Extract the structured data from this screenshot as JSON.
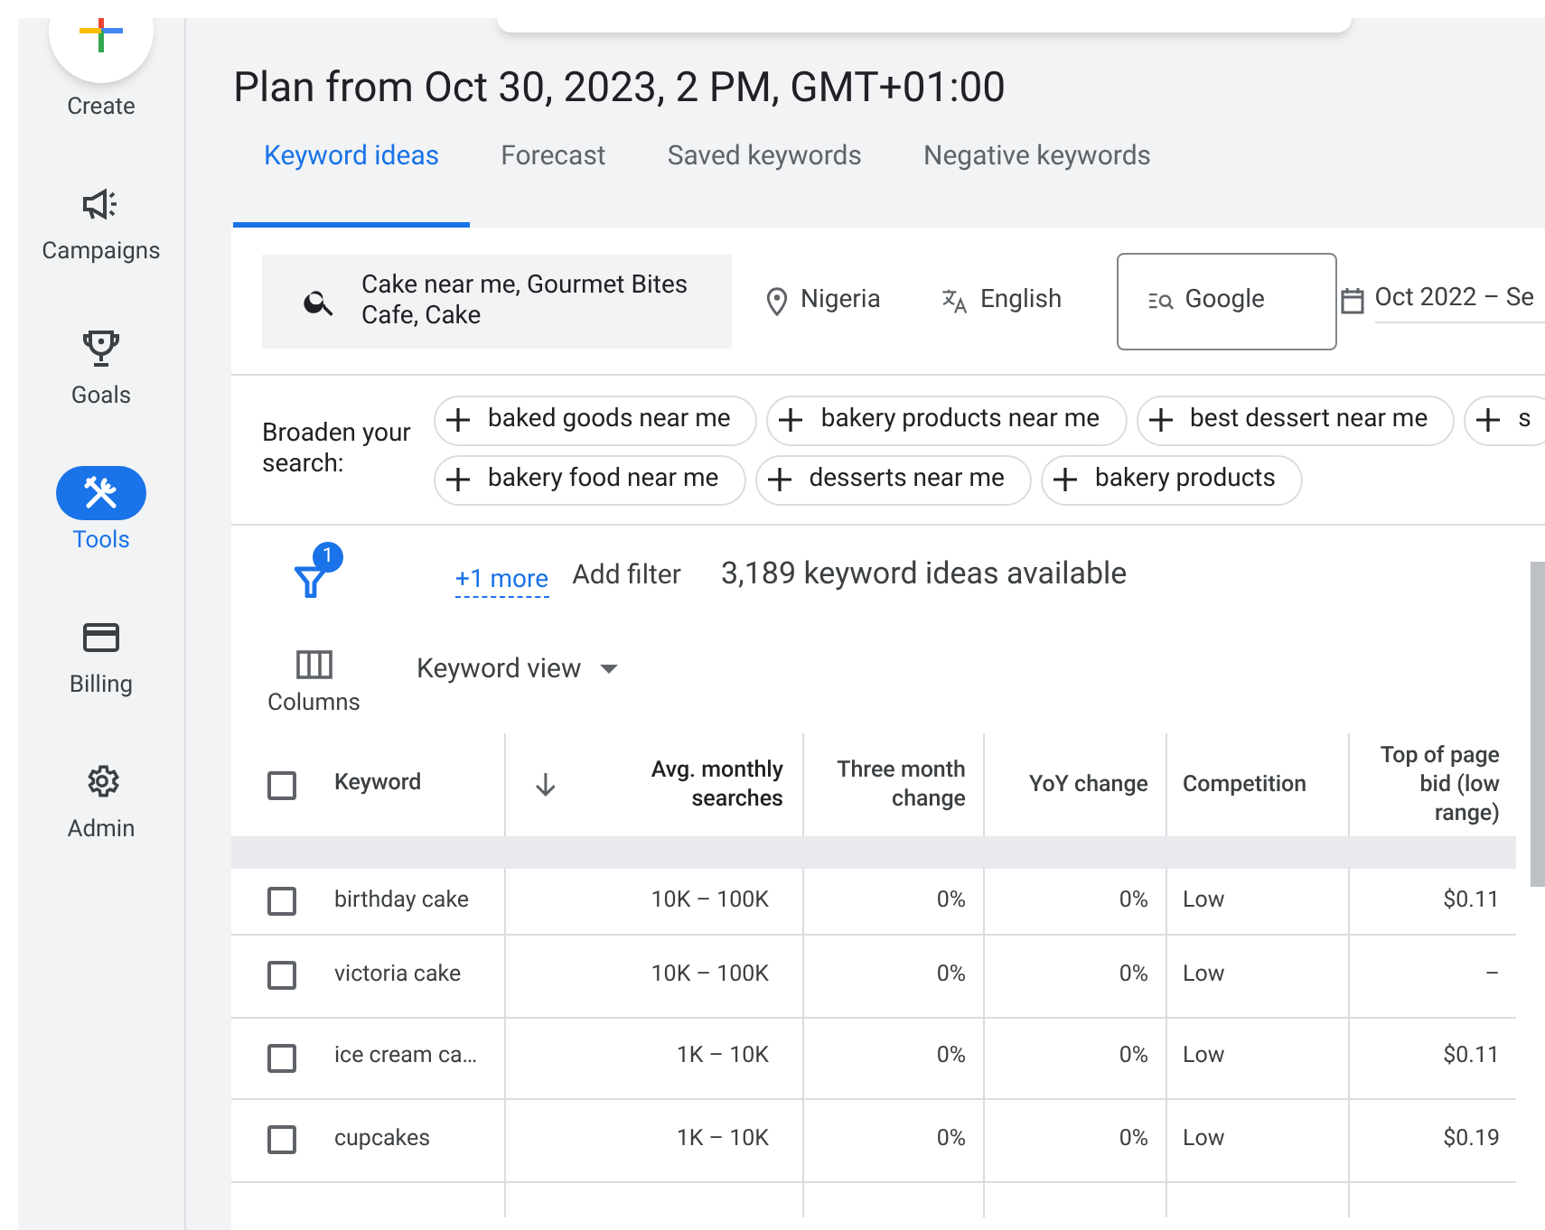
{
  "sidebar": {
    "create_label": "Create",
    "items": [
      {
        "label": "Campaigns",
        "kind": "campaigns",
        "selected": false
      },
      {
        "label": "Goals",
        "kind": "goals",
        "selected": false
      },
      {
        "label": "Tools",
        "kind": "tools",
        "selected": true
      },
      {
        "label": "Billing",
        "kind": "billing",
        "selected": false
      },
      {
        "label": "Admin",
        "kind": "admin",
        "selected": false
      }
    ]
  },
  "title": "Plan from Oct 30, 2023, 2 PM, GMT+01:00",
  "tabs": [
    {
      "label": "Keyword ideas",
      "selected": true
    },
    {
      "label": "Forecast",
      "selected": false
    },
    {
      "label": "Saved keywords",
      "selected": false
    },
    {
      "label": "Negative keywords",
      "selected": false
    }
  ],
  "search": {
    "value": "Cake near me, Gourmet Bites Cafe, Cake"
  },
  "location": "Nigeria",
  "language": "English",
  "network": "Google",
  "date_range": "Oct 2022 – Se",
  "broaden": {
    "label": "Broaden your search:",
    "chip_rows": [
      [
        "baked goods near me",
        "bakery products near me",
        "best dessert near me",
        "s"
      ],
      [
        "bakery food near me",
        "desserts near me",
        "bakery products"
      ]
    ]
  },
  "filter": {
    "badge": "1",
    "more_link": "+1 more",
    "add_filter": "Add filter",
    "count_text": "3,189 keyword ideas available"
  },
  "columns_button": "Columns",
  "view_dropdown": "Keyword view",
  "table": {
    "header_checked": false,
    "columns": [
      "Keyword",
      "Avg. monthly searches",
      "Three month change",
      "YoY change",
      "Competition",
      "Top of page bid (low range)"
    ],
    "rows": [
      {
        "checked": false,
        "cells": [
          "birthday cake",
          "10K – 100K",
          "0%",
          "0%",
          "Low",
          "$0.11"
        ]
      },
      {
        "checked": false,
        "cells": [
          "victoria cake",
          "10K – 100K",
          "0%",
          "0%",
          "Low",
          "–"
        ]
      },
      {
        "checked": false,
        "cells": [
          "ice cream ca…",
          "1K – 10K",
          "0%",
          "0%",
          "Low",
          "$0.11"
        ]
      },
      {
        "checked": false,
        "cells": [
          "cupcakes",
          "1K – 10K",
          "0%",
          "0%",
          "Low",
          "$0.19"
        ]
      }
    ]
  }
}
